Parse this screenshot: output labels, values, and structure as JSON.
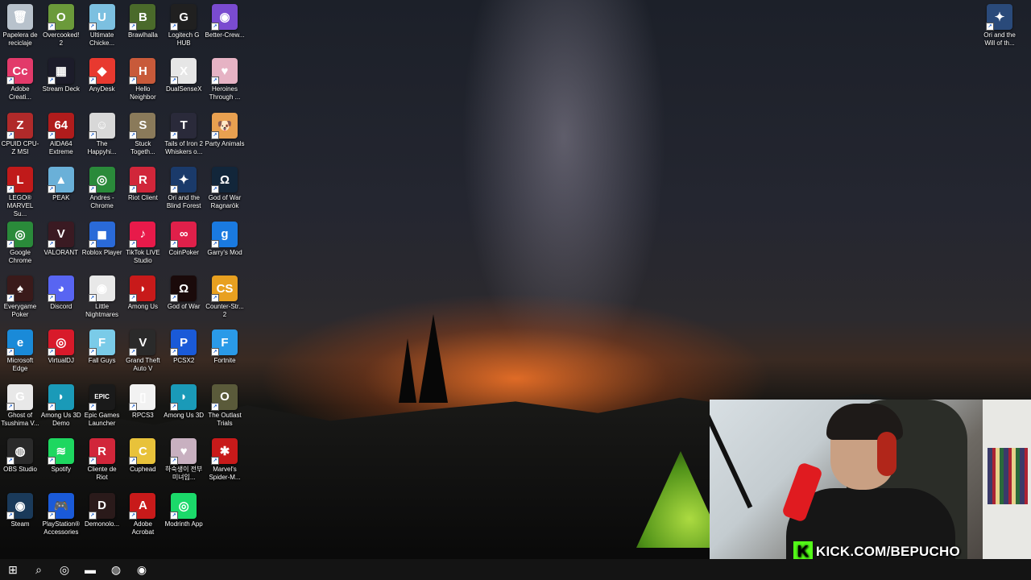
{
  "desktop": {
    "icons": [
      {
        "label": "Papelera de reciclaje",
        "icon": "recycle-bin-icon",
        "color": "#b8c2cc",
        "glyph": "🗑"
      },
      {
        "label": "Overcooked! 2",
        "icon": "overcooked-icon",
        "color": "#6b9a3a",
        "glyph": "O"
      },
      {
        "label": "Ultimate Chicke...",
        "icon": "ultimate-chicken-horse-icon",
        "color": "#7cc0e0",
        "glyph": "U"
      },
      {
        "label": "Brawlhalla",
        "icon": "brawlhalla-icon",
        "color": "#4a6a2a",
        "glyph": "B"
      },
      {
        "label": "Logitech G HUB",
        "icon": "logitech-icon",
        "color": "#202020",
        "glyph": "G"
      },
      {
        "label": "Better-Crew...",
        "icon": "better-crewlink-icon",
        "color": "#7a4bd0",
        "glyph": "◉"
      },
      {
        "label": "Adobe Creati...",
        "icon": "adobe-cc-icon",
        "color": "#e23a6a",
        "glyph": "Cc"
      },
      {
        "label": "Stream Deck",
        "icon": "stream-deck-icon",
        "color": "#1c1c2a",
        "glyph": "▦"
      },
      {
        "label": "AnyDesk",
        "icon": "anydesk-icon",
        "color": "#e8392f",
        "glyph": "◆"
      },
      {
        "label": "Hello Neighbor",
        "icon": "hello-neighbor-icon",
        "color": "#c85a3a",
        "glyph": "H"
      },
      {
        "label": "DualSenseX",
        "icon": "dualsensex-icon",
        "color": "#e6e6e6",
        "glyph": "X"
      },
      {
        "label": "Heroines Through ...",
        "icon": "heroines-icon",
        "color": "#e6b3c4",
        "glyph": "♥"
      },
      {
        "label": "CPUID CPU-Z MSI",
        "icon": "cpu-z-icon",
        "color": "#b02a2a",
        "glyph": "Z"
      },
      {
        "label": "AIDA64 Extreme",
        "icon": "aida64-icon",
        "color": "#b01c1c",
        "glyph": "64"
      },
      {
        "label": "The Happyhi...",
        "icon": "happyhills-icon",
        "color": "#d8d8d8",
        "glyph": "☺"
      },
      {
        "label": "Stuck Togeth...",
        "icon": "stuck-together-icon",
        "color": "#8a7a5a",
        "glyph": "S"
      },
      {
        "label": "Tails of Iron 2 Whiskers o...",
        "icon": "tails-of-iron-icon",
        "color": "#2a2a3a",
        "glyph": "T"
      },
      {
        "label": "Party Animals",
        "icon": "party-animals-icon",
        "color": "#e8a050",
        "glyph": "🐶"
      },
      {
        "label": "LEGO® MARVEL Su...",
        "icon": "lego-marvel-icon",
        "color": "#c01a1a",
        "glyph": "L"
      },
      {
        "label": "PEAK",
        "icon": "peak-icon",
        "color": "#6ab0d8",
        "glyph": "▲"
      },
      {
        "label": "Andres - Chrome",
        "icon": "chrome-profile-icon",
        "color": "#2a8a3a",
        "glyph": "◎"
      },
      {
        "label": "Riot Client",
        "icon": "riot-client-icon",
        "color": "#d1263a",
        "glyph": "R"
      },
      {
        "label": "Ori and the Blind Forest",
        "icon": "ori-blind-forest-icon",
        "color": "#1a3a6a",
        "glyph": "✦"
      },
      {
        "label": "God of War Ragnarök",
        "icon": "god-of-war-ragnarok-icon",
        "color": "#12263a",
        "glyph": "Ω"
      },
      {
        "label": "Google Chrome",
        "icon": "google-chrome-icon",
        "color": "#2a8a3a",
        "glyph": "◎"
      },
      {
        "label": "VALORANT",
        "icon": "valorant-icon",
        "color": "#3a1a22",
        "glyph": "V"
      },
      {
        "label": "Roblox Player",
        "icon": "roblox-icon",
        "color": "#2a6ad8",
        "glyph": "◼"
      },
      {
        "label": "TikTok LIVE Studio",
        "icon": "tiktok-live-icon",
        "color": "#e81a4a",
        "glyph": "♪"
      },
      {
        "label": "CoinPoker",
        "icon": "coinpoker-icon",
        "color": "#e0204a",
        "glyph": "∞"
      },
      {
        "label": "Garry's Mod",
        "icon": "garrys-mod-icon",
        "color": "#1a7ae0",
        "glyph": "g"
      },
      {
        "label": "Everygame Poker",
        "icon": "everygame-poker-icon",
        "color": "#3a1a1a",
        "glyph": "♠"
      },
      {
        "label": "Discord",
        "icon": "discord-icon",
        "color": "#5865f2",
        "glyph": "◕"
      },
      {
        "label": "Little Nightmares",
        "icon": "little-nightmares-icon",
        "color": "#e8e8e8",
        "glyph": "◉"
      },
      {
        "label": "Among Us",
        "icon": "among-us-icon",
        "color": "#c81a1a",
        "glyph": "◗"
      },
      {
        "label": "God of War",
        "icon": "god-of-war-icon",
        "color": "#1a0a0a",
        "glyph": "Ω"
      },
      {
        "label": "Counter-Str... 2",
        "icon": "counter-strike-icon",
        "color": "#e8a020",
        "glyph": "CS"
      },
      {
        "label": "Microsoft Edge",
        "icon": "edge-icon",
        "color": "#1a8ad8",
        "glyph": "e"
      },
      {
        "label": "VirtualDJ",
        "icon": "virtualdj-icon",
        "color": "#d81a2a",
        "glyph": "◎"
      },
      {
        "label": "Fall Guys",
        "icon": "fall-guys-icon",
        "color": "#7acbe8",
        "glyph": "F"
      },
      {
        "label": "Grand Theft Auto V",
        "icon": "gta-v-icon",
        "color": "#2a2a2a",
        "glyph": "V"
      },
      {
        "label": "PCSX2",
        "icon": "pcsx2-icon",
        "color": "#1a5ad8",
        "glyph": "P"
      },
      {
        "label": "Fortnite",
        "icon": "fortnite-icon",
        "color": "#2a9ae8",
        "glyph": "F"
      },
      {
        "label": "Ghost of Tsushima V...",
        "icon": "ghost-of-tsushima-icon",
        "color": "#e8e8e8",
        "glyph": "G"
      },
      {
        "label": "Among Us 3D Demo",
        "icon": "among-us-3d-demo-icon",
        "color": "#1a9ab8",
        "glyph": "◗"
      },
      {
        "label": "Epic Games Launcher",
        "icon": "epic-games-icon",
        "color": "#1a1a1a",
        "glyph": "EPIC"
      },
      {
        "label": "RPCS3",
        "icon": "rpcs3-icon",
        "color": "#f2f2f2",
        "glyph": "▯"
      },
      {
        "label": "Among Us 3D",
        "icon": "among-us-3d-icon",
        "color": "#1a9ab8",
        "glyph": "◗"
      },
      {
        "label": "The Outlast Trials",
        "icon": "outlast-trials-icon",
        "color": "#5a5a3a",
        "glyph": "O"
      },
      {
        "label": "OBS Studio",
        "icon": "obs-studio-icon",
        "color": "#2a2a2a",
        "glyph": "◍"
      },
      {
        "label": "Spotify",
        "icon": "spotify-icon",
        "color": "#1ed760",
        "glyph": "≋"
      },
      {
        "label": "Cliente de Riot",
        "icon": "riot-client-es-icon",
        "color": "#d1263a",
        "glyph": "R"
      },
      {
        "label": "Cuphead",
        "icon": "cuphead-icon",
        "color": "#e8c23a",
        "glyph": "C"
      },
      {
        "label": "하숙생이 전부 미녀입...",
        "icon": "korean-game-icon",
        "color": "#c8b0c0",
        "glyph": "♥"
      },
      {
        "label": "Marvel's Spider-M...",
        "icon": "spider-man-icon",
        "color": "#c81a1a",
        "glyph": "✱"
      },
      {
        "label": "Steam",
        "icon": "steam-icon",
        "color": "#1a3a5a",
        "glyph": "◉"
      },
      {
        "label": "PlayStation® Accessories",
        "icon": "playstation-accessories-icon",
        "color": "#1a5ad8",
        "glyph": "🎮"
      },
      {
        "label": "Demonolo...",
        "icon": "demonologist-icon",
        "color": "#2a1a1a",
        "glyph": "D"
      },
      {
        "label": "Adobe Acrobat",
        "icon": "adobe-acrobat-icon",
        "color": "#c81a1a",
        "glyph": "A"
      },
      {
        "label": "Modrinth App",
        "icon": "modrinth-icon",
        "color": "#1bd96a",
        "glyph": "◎"
      }
    ],
    "corner_icon": {
      "label": "Ori and the Will of th...",
      "icon": "ori-will-of-wisps-icon",
      "color": "#2a4a7a",
      "glyph": "✦"
    }
  },
  "taskbar": {
    "items": [
      {
        "name": "start-button",
        "glyph": "⊞"
      },
      {
        "name": "search-button",
        "glyph": "⌕"
      },
      {
        "name": "taskbar-chrome",
        "glyph": "◎"
      },
      {
        "name": "taskbar-file-explorer",
        "glyph": "▬"
      },
      {
        "name": "taskbar-obs",
        "glyph": "◍"
      },
      {
        "name": "taskbar-steam",
        "glyph": "◉"
      }
    ],
    "background": "#141414"
  },
  "webcam": {
    "overlay_text": "KICK.COM/BEPUCHO",
    "logo_letter": "K",
    "brand_color": "#53fc18"
  }
}
